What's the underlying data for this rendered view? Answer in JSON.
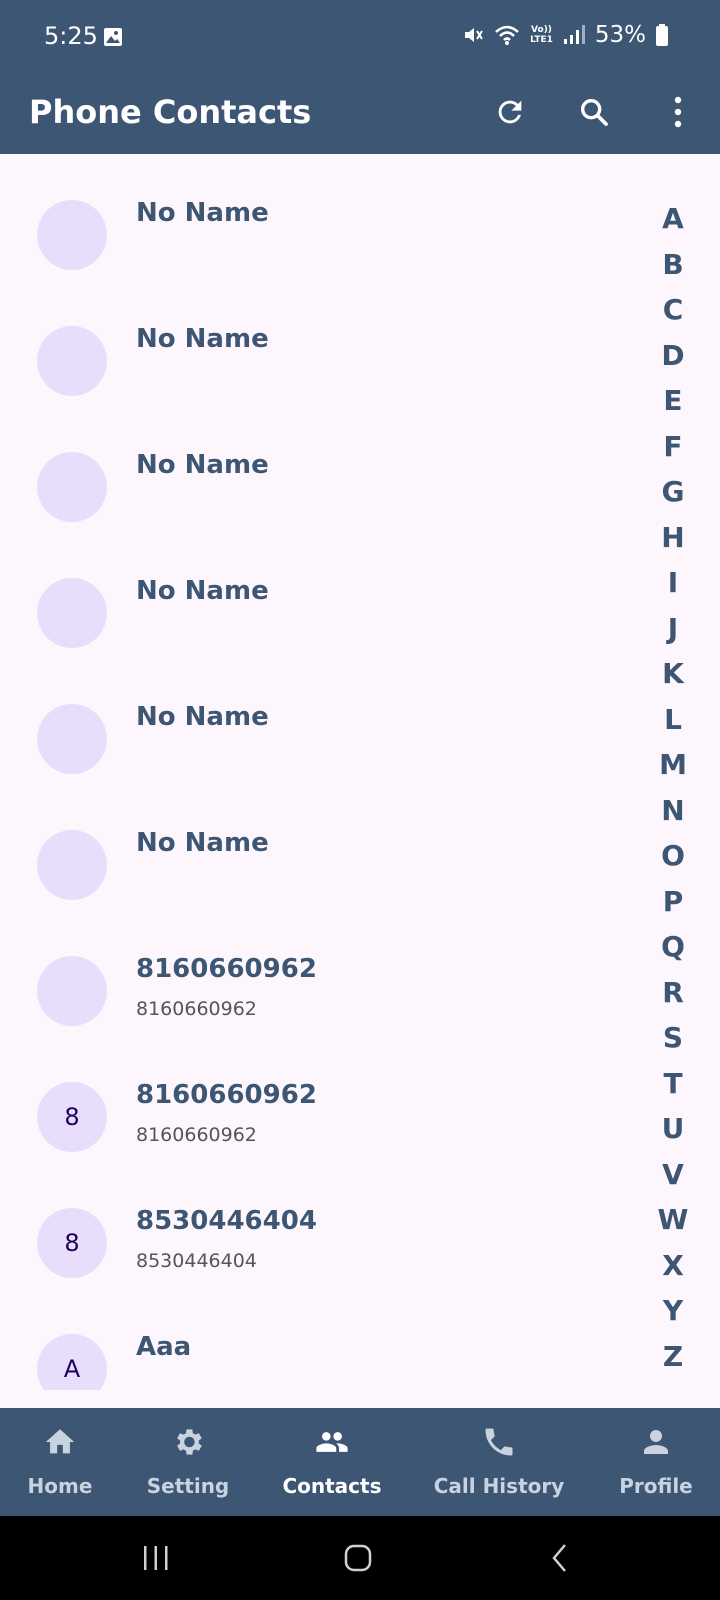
{
  "status_bar": {
    "time": "5:25",
    "battery": "53%"
  },
  "app_bar": {
    "title": "Phone Contacts",
    "actions": [
      "refresh-icon",
      "search-icon",
      "more-vert-icon"
    ]
  },
  "contacts": [
    {
      "initial": "",
      "name": "No Name",
      "phone": ""
    },
    {
      "initial": "",
      "name": "No Name",
      "phone": ""
    },
    {
      "initial": "",
      "name": "No Name",
      "phone": ""
    },
    {
      "initial": "",
      "name": "No Name",
      "phone": ""
    },
    {
      "initial": "",
      "name": "No Name",
      "phone": ""
    },
    {
      "initial": "",
      "name": "No Name",
      "phone": ""
    },
    {
      "initial": "",
      "name": "8160660962",
      "phone": "8160660962"
    },
    {
      "initial": "8",
      "name": "8160660962",
      "phone": "8160660962"
    },
    {
      "initial": "8",
      "name": "8530446404",
      "phone": "8530446404"
    },
    {
      "initial": "A",
      "name": "Aaa",
      "phone": ""
    }
  ],
  "alphabet": [
    "A",
    "B",
    "C",
    "D",
    "E",
    "F",
    "G",
    "H",
    "I",
    "J",
    "K",
    "L",
    "M",
    "N",
    "O",
    "P",
    "Q",
    "R",
    "S",
    "T",
    "U",
    "V",
    "W",
    "X",
    "Y",
    "Z"
  ],
  "bottom_nav": [
    {
      "label": "Home",
      "icon": "home-icon",
      "active": false
    },
    {
      "label": "Setting",
      "icon": "gear-icon",
      "active": false
    },
    {
      "label": "Contacts",
      "icon": "people-icon",
      "active": true
    },
    {
      "label": "Call History",
      "icon": "phone-icon",
      "active": false
    },
    {
      "label": "Profile",
      "icon": "person-icon",
      "active": false
    }
  ],
  "colors": {
    "primary": "#3c5674",
    "background": "#fdf7fd",
    "avatar": "#e8defb"
  }
}
